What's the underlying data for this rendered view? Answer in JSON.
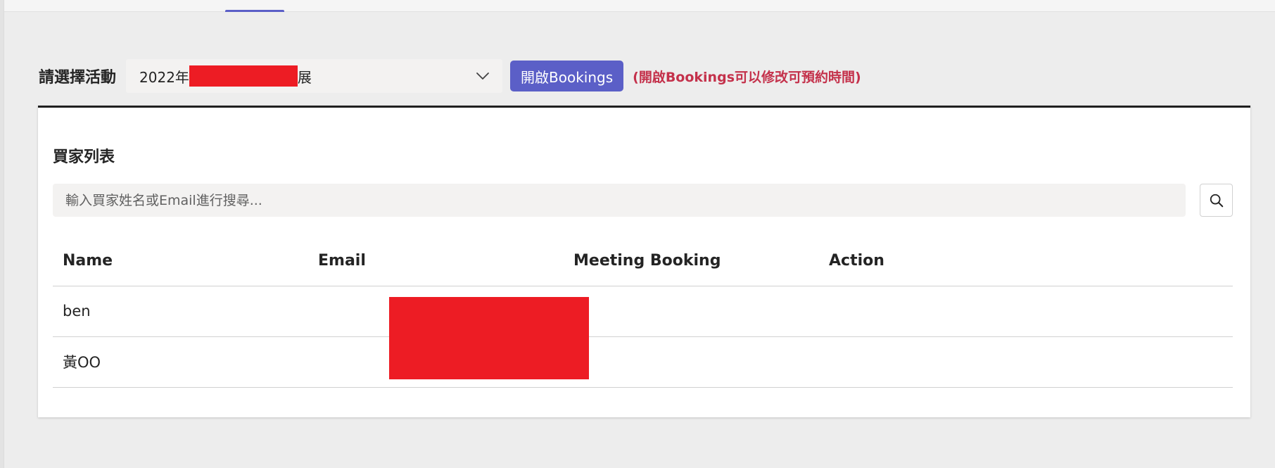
{
  "header": {
    "active_tab_color": "#5b5fc7"
  },
  "activity": {
    "label": "請選擇活動",
    "selected_prefix": "2022年",
    "selected_suffix": "展",
    "open_button_label": "開啟Bookings",
    "hint": "(開啟Bookings可以修改可預約時間)"
  },
  "buyers": {
    "title": "買家列表",
    "search_placeholder": "輸入買家姓名或Email進行搜尋...",
    "columns": [
      "Name",
      "Email",
      "Meeting Booking",
      "Action"
    ],
    "rows": [
      {
        "name": "ben",
        "email": "",
        "meeting_booking": "",
        "action": ""
      },
      {
        "name": "黃OO",
        "email": "",
        "meeting_booking": "",
        "action": ""
      }
    ]
  },
  "icons": {
    "dropdown": "chevron-down-icon",
    "search": "search-icon"
  },
  "colors": {
    "accent": "#5b5fc7",
    "hint": "#c4314b",
    "redaction": "#ed1c24"
  }
}
